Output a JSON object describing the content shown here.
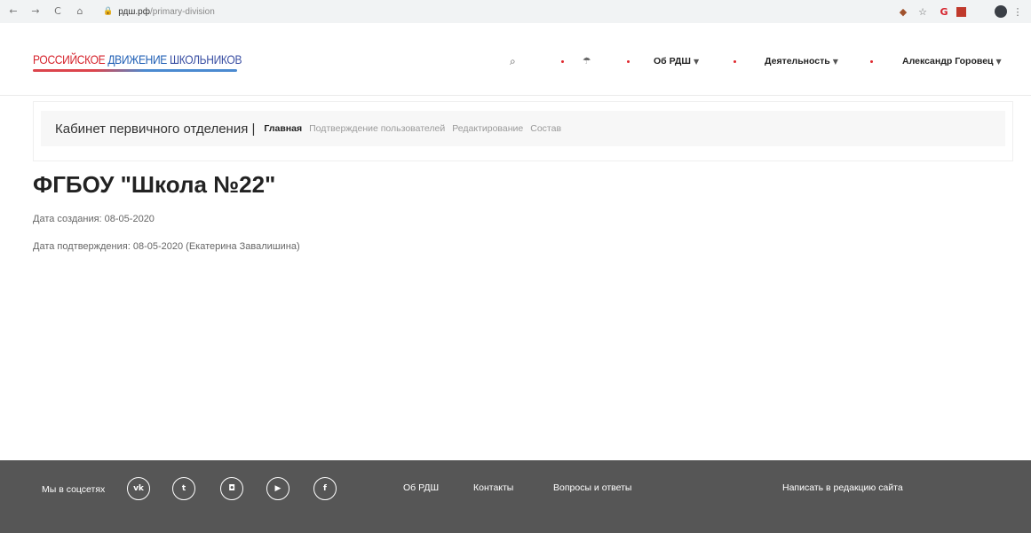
{
  "browser": {
    "url_host": "рдш.рф",
    "url_path": "/primary-division",
    "nav": {
      "back": "←",
      "forward": "→",
      "reload": "C",
      "home": "⌂"
    },
    "extensions": [
      "ext-shield-icon",
      "star-icon",
      "ext-red-icon",
      "ext-square-icon",
      "profile-avatar",
      "menu-kebab-icon"
    ]
  },
  "header": {
    "logo": {
      "word1": "РОССИЙСКОЕ",
      "word2": "ДВИЖЕНИЕ",
      "word3": "ШКОЛЬНИКОВ"
    },
    "nav": {
      "search_icon": "🔍",
      "umbrella_icon": "☂",
      "about": "Об РДШ",
      "activity": "Деятельность",
      "user": "Александр Горовец"
    }
  },
  "cabinet": {
    "title": "Кабинет первичного отделения |",
    "tabs": [
      {
        "label": "Главная",
        "active": true
      },
      {
        "label": "Подтверждение пользователей",
        "active": false
      },
      {
        "label": "Редактирование",
        "active": false
      },
      {
        "label": "Состав",
        "active": false
      }
    ]
  },
  "main": {
    "title": "ФГБОУ \"Школа №22\"",
    "created": "Дата создания: 08-05-2020",
    "confirmed": "Дата подтверждения: 08-05-2020 (Екатерина Завалишина)"
  },
  "footer": {
    "social_label": "Мы в соцсетях",
    "social": [
      {
        "name": "vk-icon",
        "glyph": "vk"
      },
      {
        "name": "twitter-icon",
        "glyph": "t"
      },
      {
        "name": "instagram-icon",
        "glyph": "◘"
      },
      {
        "name": "youtube-icon",
        "glyph": "▶"
      },
      {
        "name": "facebook-icon",
        "glyph": "f"
      }
    ],
    "links": [
      "Об РДШ",
      "Контакты",
      "Вопросы и ответы"
    ],
    "write": "Написать в редакцию сайта"
  },
  "colors": {
    "accent_red": "#e0282e",
    "brand_blue": "#1f5fb5",
    "footer_bg": "#565656"
  }
}
